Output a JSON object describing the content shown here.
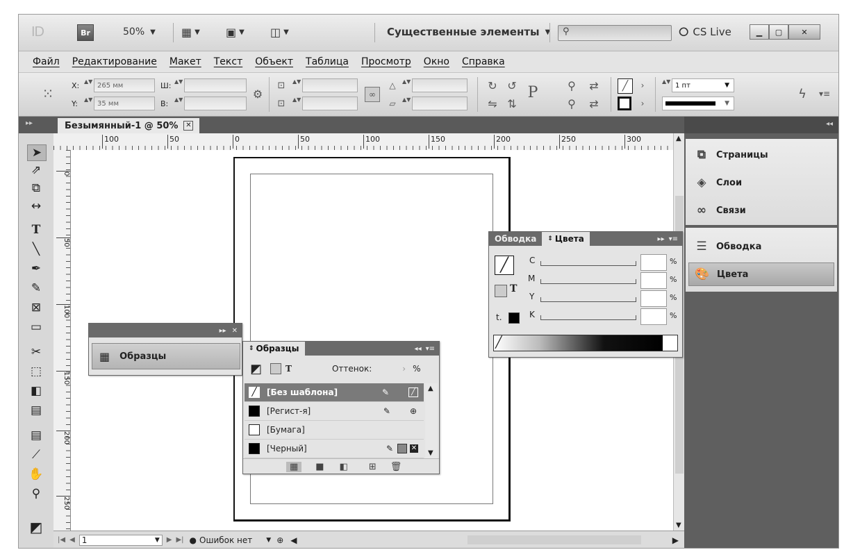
{
  "appbar": {
    "logo": "ID",
    "bridge": "Br",
    "zoom": "50%",
    "workspace": "Существенные элементы",
    "cslive": "CS Live"
  },
  "menu": [
    "Файл",
    "Редактирование",
    "Макет",
    "Текст",
    "Объект",
    "Таблица",
    "Просмотр",
    "Окно",
    "Справка"
  ],
  "control": {
    "x_label": "X:",
    "x_value": "265 мм",
    "y_label": "Y:",
    "y_value": "35 мм",
    "w_label": "Ш:",
    "h_label": "В:",
    "stroke_weight": "1 пт"
  },
  "document": {
    "tab_title": "Безымянный-1 @ 50%",
    "close": "✕"
  },
  "hruler_ticks": [
    "100",
    "50",
    "0",
    "50",
    "100",
    "150",
    "200",
    "250",
    "300"
  ],
  "vruler_ticks": [
    "0",
    "50",
    "100",
    "150",
    "200",
    "250"
  ],
  "status": {
    "page": "1",
    "errors": "Ошибок нет"
  },
  "dock": {
    "group1": [
      {
        "label": "Страницы",
        "icon": "pages-icon"
      },
      {
        "label": "Слои",
        "icon": "layers-icon"
      },
      {
        "label": "Связи",
        "icon": "links-icon"
      }
    ],
    "group2": [
      {
        "label": "Обводка",
        "icon": "stroke-icon"
      },
      {
        "label": "Цвета",
        "icon": "color-icon"
      }
    ]
  },
  "swatches_collapsed": {
    "label": "Образцы"
  },
  "color_panel": {
    "tab_stroke": "Обводка",
    "tab_color": "Цвета",
    "channels": [
      "C",
      "M",
      "Y",
      "K"
    ],
    "unit": "%"
  },
  "swatches_panel": {
    "title": "Образцы",
    "tint_label": "Оттенок:",
    "tint_unit": "%",
    "items": [
      "[Без шаблона]",
      "[Регист-я]",
      "[Бумага]",
      "[Черный]"
    ]
  }
}
